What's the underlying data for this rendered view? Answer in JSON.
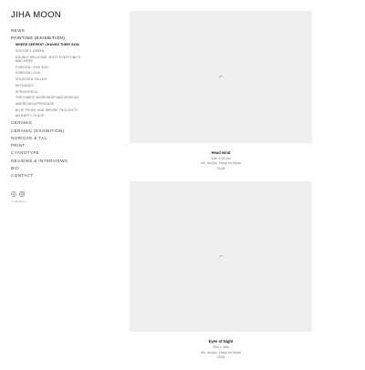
{
  "site": {
    "title": "JIHA MOON"
  },
  "nav": {
    "news": "NEWS",
    "painting": "PAINTING (EXHIBITION)",
    "painting_sub": [
      "WHERE SERPENT CHANGE THEIR SKIN",
      "VISITOR'S GREEN",
      "DOUBLE WELCOME: MOST EVERYONE'S MAD HERE",
      "FOREIGN LOVE TOO",
      "FOREIGN LOVE",
      "SOLVEGEN FALLER",
      "KETGUNGY",
      "SPRINGFIELD",
      "THE FABRIC WORKSHOP AND MUSEUM",
      "AMERICAN APPENDAGE",
      "BLUE PEONY AND IMPURE THOUGHTS",
      "AN EMPTY PLACE"
    ],
    "ceramic": "CERAMIC",
    "ceramic_exhibition": "CERAMIC (EXHIBITION)",
    "norigae": "NORIGAE & TAL",
    "print": "PRINT",
    "cyanotype": "CYANOTYPE",
    "reviews": "REVIEWS & INTERVIEWS",
    "bio": "BIO",
    "contact": "CONTACT"
  },
  "social": {
    "facebook_icon": "facebook-icon",
    "instagram_icon": "instagram-icon"
  },
  "footer": {
    "copyright": "© Jiha Moon"
  },
  "artworks": [
    {
      "title": "Head wind",
      "dimensions": "40in x 56.5in",
      "medium": "Ink, Acrylic, Hanji on Mylar",
      "year": "2018"
    },
    {
      "title": "Eyes of Night",
      "dimensions": "25in x 36in",
      "medium": "Ink, Acrylic, Hanji on Mylar",
      "year": "2018"
    }
  ],
  "colors": {
    "placeholder": "#efefef",
    "text": "#222222",
    "muted": "#777777"
  }
}
